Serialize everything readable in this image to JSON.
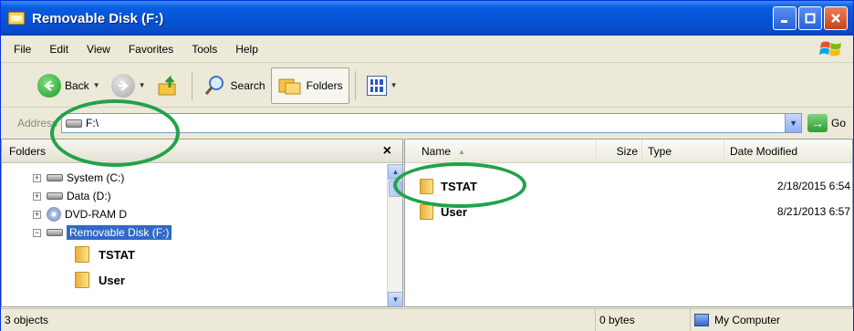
{
  "window": {
    "title": "Removable Disk (F:)"
  },
  "menu": [
    "File",
    "Edit",
    "View",
    "Favorites",
    "Tools",
    "Help"
  ],
  "toolbar": {
    "back": "Back",
    "search": "Search",
    "folders": "Folders"
  },
  "address": {
    "label": "Address",
    "value": "F:\\",
    "go": "Go"
  },
  "folders_pane": {
    "title": "Folders",
    "close": "×",
    "tree": [
      {
        "label": "System (C:)",
        "expander": "+"
      },
      {
        "label": "Data (D:)",
        "expander": "+"
      },
      {
        "label": "DVD-RAM D",
        "expander": "+"
      },
      {
        "label": "Removable Disk (F:)",
        "expander": "−"
      }
    ],
    "children": [
      "TSTAT",
      "User"
    ]
  },
  "files_pane": {
    "columns": {
      "name": "Name",
      "size": "Size",
      "type": "Type",
      "date": "Date Modified"
    },
    "rows": [
      {
        "name": "TSTAT",
        "date": "2/18/2015 6:54"
      },
      {
        "name": "User",
        "date": "8/21/2013 6:57"
      }
    ]
  },
  "status": {
    "objects": "3 objects",
    "size": "0 bytes",
    "location": "My Computer"
  },
  "colors": {
    "title_bar": "#0454d8",
    "selection": "#316ac5",
    "annotation": "#22a24a",
    "folder": "#e8b13a"
  }
}
